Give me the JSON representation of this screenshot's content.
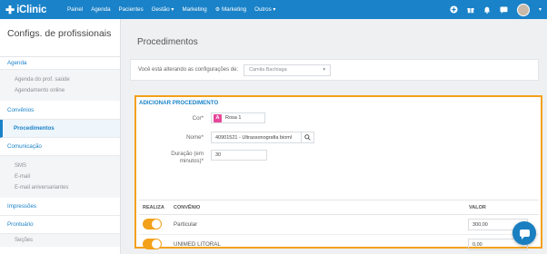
{
  "brand": {
    "name": "iClinic",
    "logo_mark": "✚"
  },
  "topnav": {
    "items": [
      {
        "label": "Painel"
      },
      {
        "label": "Agenda"
      },
      {
        "label": "Pacientes"
      },
      {
        "label": "Gestão ▾"
      },
      {
        "label": "Marketing"
      },
      {
        "label": "⚙ Marketing"
      },
      {
        "label": "Outros ▾"
      }
    ],
    "right_icons": [
      "add-icon",
      "gift-icon",
      "bell-icon",
      "message-icon",
      "user-avatar"
    ]
  },
  "sidebar": {
    "title": "Configs. de profissionais",
    "agenda": {
      "label": "Agenda",
      "items": [
        "Agenda do prof. saúde",
        "Agendamento online"
      ]
    },
    "convenios": "Convênios",
    "procedimentos": "Procedimentos",
    "comunicacao": {
      "label": "Comunicação",
      "items": [
        "SMS",
        "E-mail",
        "E-mail aniversariantes"
      ]
    },
    "impressoes": "Impressões",
    "prontuario": {
      "label": "Prontuário",
      "items": [
        "Seções"
      ]
    }
  },
  "main": {
    "page_title": "Procedimentos",
    "alter_label": "Você está alterando as configurações de:",
    "alter_value": "Camila Bachiaga"
  },
  "add_form": {
    "title": "ADICIONAR PROCEDIMENTO",
    "cor_label": "Cor*",
    "cor_badge": "A",
    "cor_value": "Rosa 1",
    "nome_label": "Nome*",
    "nome_value": "40901521 - Ultrassonografia bioml",
    "duracao_label_1": "Duração (em",
    "duracao_label_2": "minutos)*",
    "duracao_value": "30",
    "table": {
      "headers": {
        "realiza": "REALIZA",
        "convenio": "CONVÊNIO",
        "valor": "VALOR"
      },
      "rows": [
        {
          "convenio": "Particular",
          "valor": "300,00",
          "realiza": true
        },
        {
          "convenio": "UNIMED LITORAL",
          "valor": "0,00",
          "realiza": true
        }
      ]
    }
  },
  "colors": {
    "accent": "#1a82c8",
    "highlight": "#f3a11a",
    "swatch": "#e8479a"
  }
}
